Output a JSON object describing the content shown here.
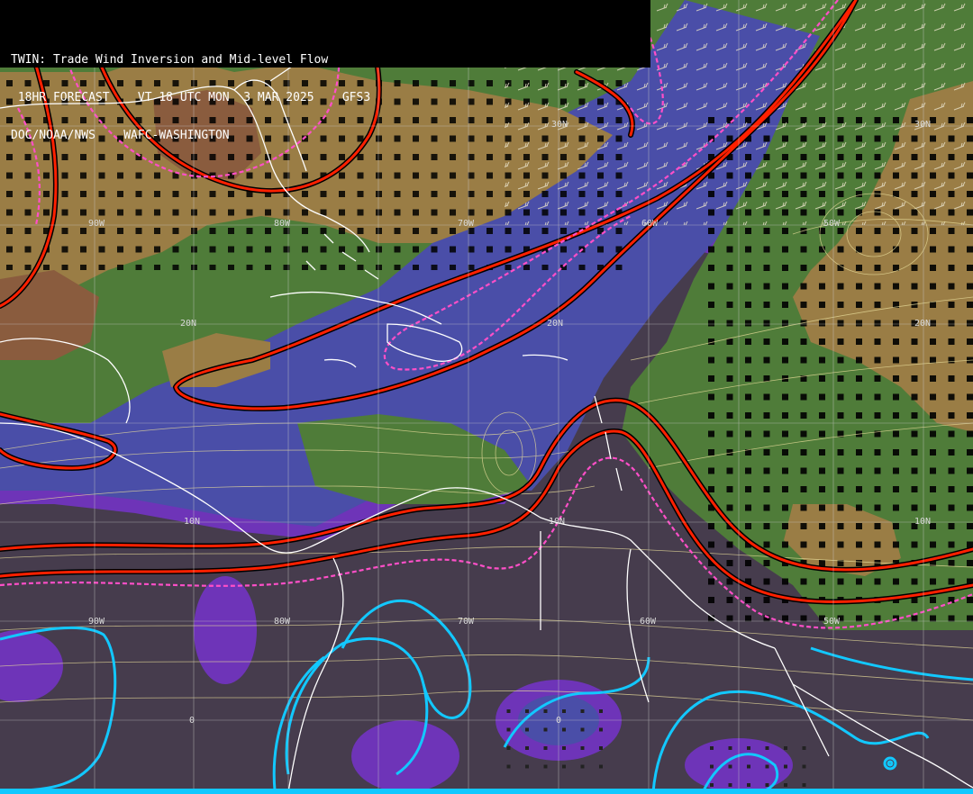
{
  "header": {
    "title": "TWIN: Trade Wind Inversion and Mid-level Flow",
    "forecast_line": " 18HR FORECAST    VT 18 UTC MON  3 MAR 2025    GFS3",
    "agency_line": "DOC/NOAA/NWS    WAFC-WASHINGTON"
  },
  "grid_labels": {
    "lat_30n_a": "30N",
    "lat_30n_b": "30N",
    "lat_20n_a": "20N",
    "lat_20n_b": "20N",
    "lat_20n_c": "20N",
    "lat_10n_a": "10N",
    "lat_10n_b": "10N",
    "lat_10n_c": "10N",
    "lat_0_a": "0",
    "lat_0_b": "0",
    "lon_90w_a": "90W",
    "lon_80w_a": "80W",
    "lon_70w_a": "70W",
    "lon_60w_a": "60W",
    "lon_50w_a": "50W",
    "lon_90w_b": "90W",
    "lon_80w_b": "80W",
    "lon_70w_b": "70W",
    "lon_60w_b": "60W",
    "lon_50w_b": "50W"
  },
  "colors": {
    "background_low": "#463c4d",
    "purple": "#6e34b8",
    "blue": "#4a4ea8",
    "green": "#4f7c39",
    "tan": "#9a7d45",
    "brown": "#8a5c3e",
    "red_contour": "#ff2000",
    "magenta_dash": "#ff4fc8",
    "cyan_contour": "#12c8ff",
    "coast": "#ffffff",
    "grid": "#c8c8c8",
    "streamline": "#e8dc9a"
  }
}
